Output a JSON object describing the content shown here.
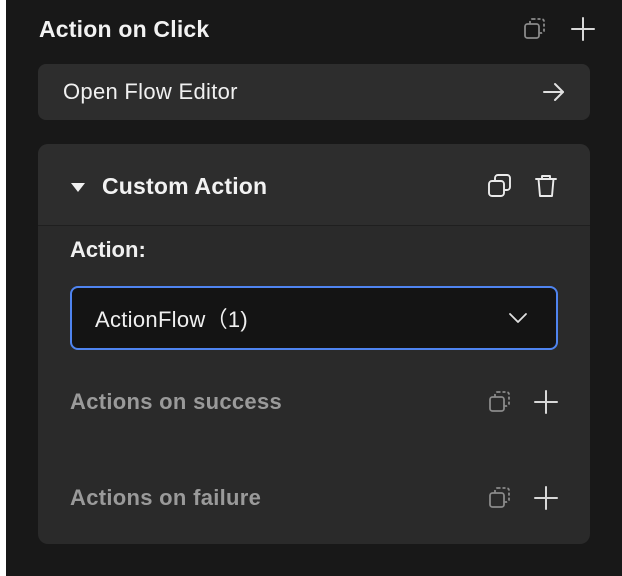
{
  "section": {
    "title": "Action on Click",
    "icons": [
      "duplicate-icon",
      "plus-icon"
    ]
  },
  "open_flow_editor": {
    "label": "Open Flow Editor",
    "icon": "arrow-right-icon"
  },
  "custom_action": {
    "title": "Custom Action",
    "icons": [
      "copy-icon",
      "trash-icon"
    ],
    "action_label": "Action:",
    "select": {
      "value": "ActionFlow（1)",
      "icon": "chevron-down-icon"
    },
    "on_success_label": "Actions on success",
    "on_failure_label": "Actions on failure"
  },
  "colors": {
    "panel_bg": "#181818",
    "card_bg": "#2a2a2a",
    "button_bg": "#2d2d2d",
    "select_border": "#4f84f0",
    "muted_text": "#9a9a9a"
  }
}
